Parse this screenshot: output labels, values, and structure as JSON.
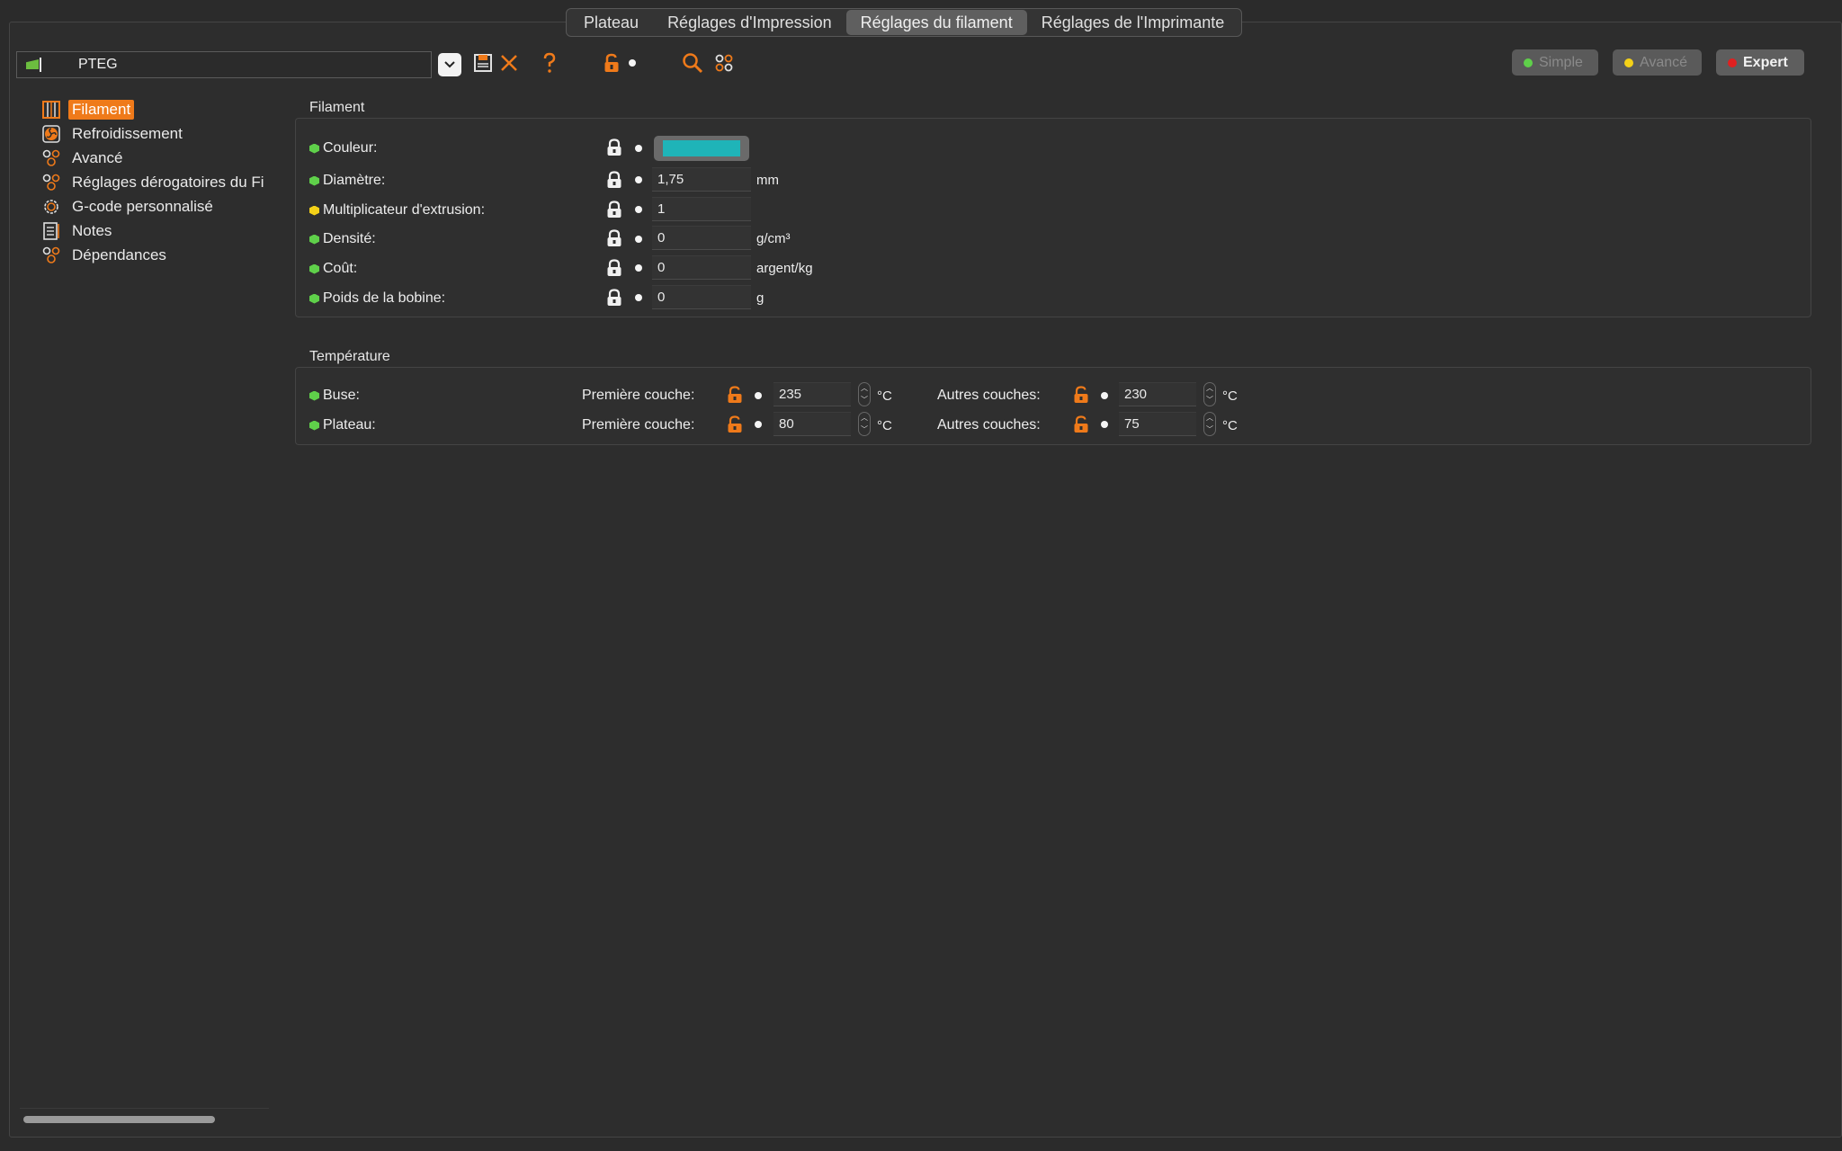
{
  "tabs": [
    {
      "label": "Plateau",
      "active": false
    },
    {
      "label": "Réglages d'Impression",
      "active": false
    },
    {
      "label": "Réglages du filament",
      "active": true
    },
    {
      "label": "Réglages de l'Imprimante",
      "active": false
    }
  ],
  "toolbar": {
    "preset_name": "PTEG",
    "icons": [
      "dropdown-icon",
      "save-icon",
      "delete-icon",
      "help-icon",
      "unlock-icon",
      "search-icon",
      "compare-icon"
    ]
  },
  "modes": [
    {
      "label": "Simple",
      "color": "#5fd04a",
      "active": false
    },
    {
      "label": "Avancé",
      "color": "#f4d118",
      "active": false
    },
    {
      "label": "Expert",
      "color": "#e02020",
      "active": true
    }
  ],
  "sidebar": {
    "items": [
      {
        "label": "Filament",
        "icon": "spool-icon",
        "active": true
      },
      {
        "label": "Refroidissement",
        "icon": "fan-icon",
        "active": false
      },
      {
        "label": "Avancé",
        "icon": "cogs-icon",
        "active": false
      },
      {
        "label": "Réglages dérogatoires du Fi",
        "icon": "cogs-icon",
        "active": false
      },
      {
        "label": "G-code personnalisé",
        "icon": "gear-icon",
        "active": false
      },
      {
        "label": "Notes",
        "icon": "notes-icon",
        "active": false
      },
      {
        "label": "Dépendances",
        "icon": "cogs-icon",
        "active": false
      }
    ]
  },
  "filament": {
    "title": "Filament",
    "rows": [
      {
        "label": "Couleur:",
        "status": "green",
        "value": "",
        "unit": ""
      },
      {
        "label": "Diamètre:",
        "status": "green",
        "value": "1,75",
        "unit": "mm"
      },
      {
        "label": "Multiplicateur d'extrusion:",
        "status": "yellow",
        "value": "1",
        "unit": ""
      },
      {
        "label": "Densité:",
        "status": "green",
        "value": "0",
        "unit": "g/cm³"
      },
      {
        "label": "Coût:",
        "status": "green",
        "value": "0",
        "unit": "argent/kg"
      },
      {
        "label": "Poids de la bobine:",
        "status": "green",
        "value": "0",
        "unit": "g"
      }
    ],
    "color_value": "#1fb4b8"
  },
  "temperature": {
    "title": "Température",
    "first_layer_label": "Première couche:",
    "other_layers_label": "Autres couches:",
    "unit": "°C",
    "rows": [
      {
        "label": "Buse:",
        "first": "235",
        "other": "230"
      },
      {
        "label": "Plateau:",
        "first": "80",
        "other": "75"
      }
    ]
  },
  "colors": {
    "accent": "#ef7a1a",
    "status_green": "#5fd04a",
    "status_yellow": "#f4d118"
  }
}
